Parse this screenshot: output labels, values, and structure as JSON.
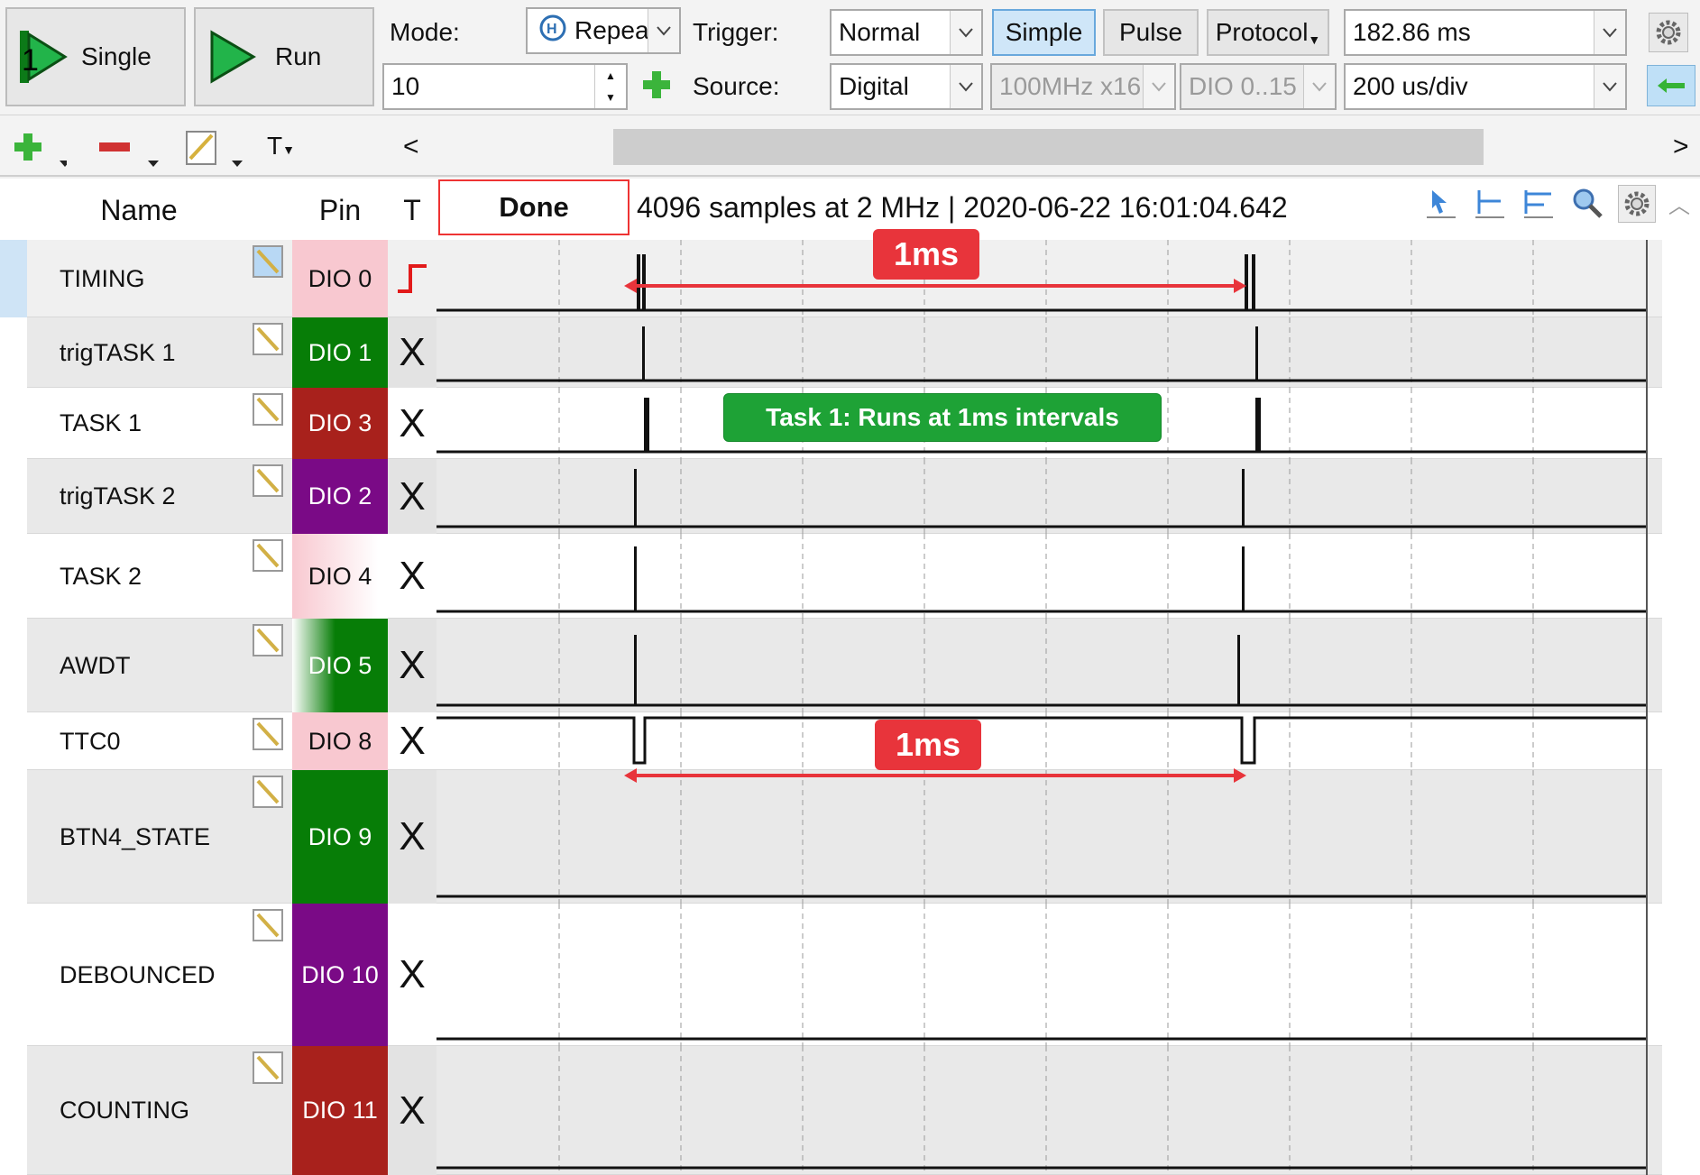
{
  "top": {
    "single_label": "Single",
    "run_label": "Run",
    "mode_label": "Mode:",
    "mode_value": "Repeat",
    "count_value": "10",
    "trigger_label": "Trigger:",
    "trigger_value": "Normal",
    "simple_label": "Simple",
    "pulse_label": "Pulse",
    "protocol_label": "Protocol",
    "position_value": "182.86 ms",
    "source_label": "Source:",
    "source_value": "Digital",
    "rate_value": "100MHz x16",
    "channels_value": "DIO 0..15",
    "base_value": "200 us/div"
  },
  "table": {
    "header_name": "Name",
    "header_pin": "Pin",
    "header_t": "T",
    "status": "Done",
    "info": "4096 samples at 2 MHz | 2020-06-22 16:01:04.642"
  },
  "channels": [
    {
      "name": "TIMING",
      "pin": "DIO  0",
      "trigger": "rise"
    },
    {
      "name": "trigTASK 1",
      "pin": "DIO  1",
      "trigger": "X"
    },
    {
      "name": "TASK 1",
      "pin": "DIO  3",
      "trigger": "X"
    },
    {
      "name": "trigTASK 2",
      "pin": "DIO  2",
      "trigger": "X"
    },
    {
      "name": "TASK 2",
      "pin": "DIO  4",
      "trigger": "X"
    },
    {
      "name": "AWDT",
      "pin": "DIO  5",
      "trigger": "X"
    },
    {
      "name": "TTC0",
      "pin": "DIO  8",
      "trigger": "X"
    },
    {
      "name": "BTN4_STATE",
      "pin": "DIO  9",
      "trigger": "X"
    },
    {
      "name": "DEBOUNCED",
      "pin": "DIO 10",
      "trigger": "X"
    },
    {
      "name": "COUNTING",
      "pin": "DIO 11",
      "trigger": "X"
    }
  ],
  "annotations": {
    "interval_top": "1ms",
    "interval_bottom": "1ms",
    "task1_note": "Task 1: Runs at 1ms intervals"
  },
  "colors": {
    "pink": "#f8c8d0",
    "green": "#077d07",
    "red": "#a8211c",
    "purple": "#7a0a86",
    "accent_red": "#e8343b",
    "note_green": "#1ea236"
  }
}
